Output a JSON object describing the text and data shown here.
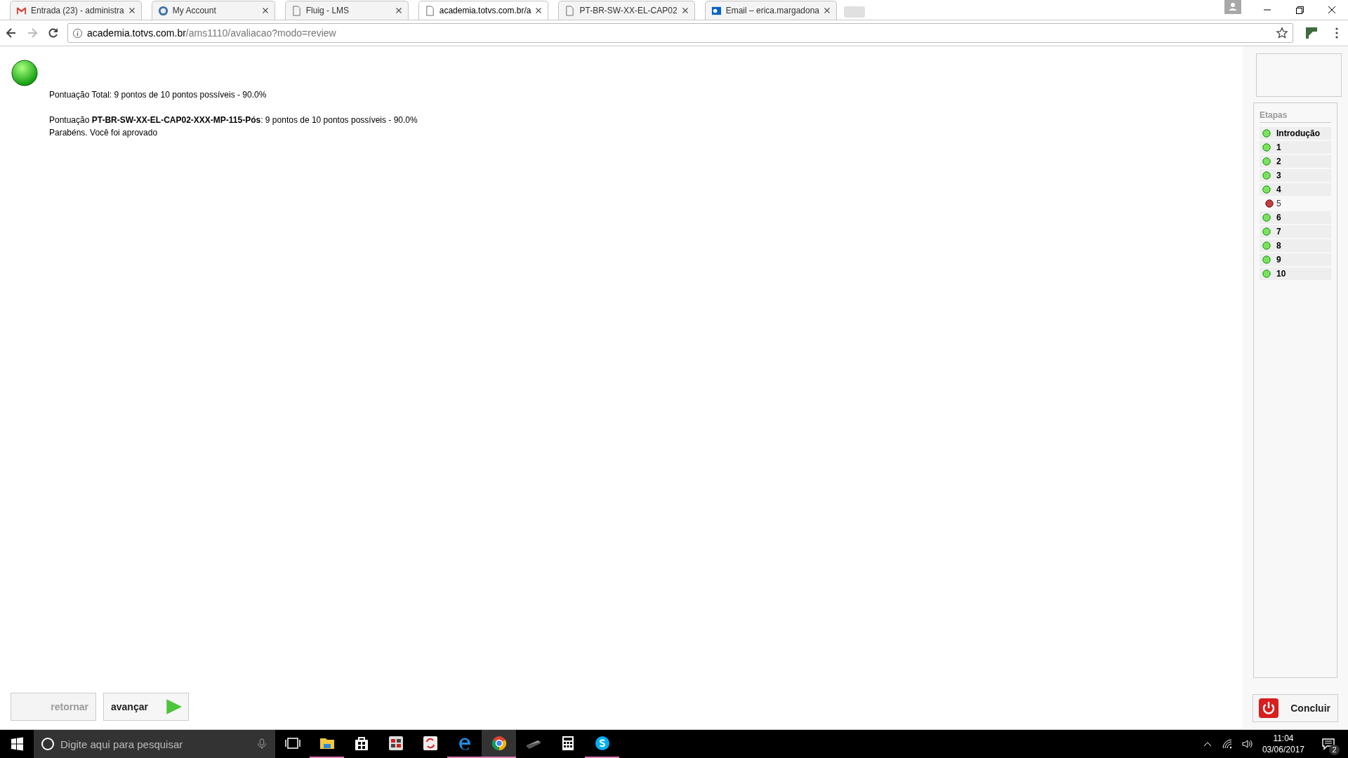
{
  "browser": {
    "tabs": [
      {
        "title": "Entrada (23) - administra",
        "kind": "gmail",
        "selected": false
      },
      {
        "title": "My Account",
        "kind": "circle",
        "selected": false
      },
      {
        "title": "Fluig - LMS",
        "kind": "page",
        "selected": false
      },
      {
        "title": "academia.totvs.com.br/a",
        "kind": "page",
        "selected": true
      },
      {
        "title": "PT-BR-SW-XX-EL-CAP02",
        "kind": "page",
        "selected": false
      },
      {
        "title": "Email – erica.margadona",
        "kind": "outlook",
        "selected": false
      }
    ],
    "url_host": "academia.totvs.com.br",
    "url_path": "/ams1110/avaliacao?modo=review"
  },
  "result": {
    "passed": true,
    "total": "Pontuação Total: 9 pontos de 10 pontos possíveis - 90.0%",
    "detail": "Pontuação **PT-BR-SW-XX-EL-CAP02-XXX-MP-115-Pós**: 9 pontos de 10 pontos possíveis - 90.0%",
    "message": "Parabéns. Você foi aprovado"
  },
  "sidebar": {
    "title": "Etapas",
    "steps": [
      {
        "label": "Introdução",
        "passed": true
      },
      {
        "label": "1",
        "passed": true
      },
      {
        "label": "2",
        "passed": true
      },
      {
        "label": "3",
        "passed": true
      },
      {
        "label": "4",
        "passed": true
      },
      {
        "label": "5",
        "passed": false
      },
      {
        "label": "6",
        "passed": true
      },
      {
        "label": "7",
        "passed": true
      },
      {
        "label": "8",
        "passed": true
      },
      {
        "label": "9",
        "passed": true
      },
      {
        "label": "10",
        "passed": true
      }
    ]
  },
  "buttons": {
    "back": {
      "label": "retornar",
      "disabled": true
    },
    "next": {
      "label": "avançar",
      "disabled": false
    },
    "finish": {
      "label": "Concluir"
    }
  },
  "taskbar": {
    "search_placeholder": "Digite aqui para pesquisar",
    "apps": [
      {
        "kind": "taskview",
        "running": false,
        "selected": false
      },
      {
        "kind": "folder",
        "running": true,
        "selected": false
      },
      {
        "kind": "store",
        "running": false,
        "selected": false
      },
      {
        "kind": "app",
        "running": false,
        "selected": false
      },
      {
        "kind": "sync",
        "running": false,
        "selected": false
      },
      {
        "kind": "edge",
        "running": true,
        "selected": false
      },
      {
        "kind": "chrome",
        "running": true,
        "selected": true
      },
      {
        "kind": "scanner",
        "running": false,
        "selected": false
      },
      {
        "kind": "calculator",
        "running": false,
        "selected": false
      },
      {
        "kind": "skype",
        "running": true,
        "selected": false
      }
    ],
    "time": "11:04",
    "date": "03/06/2017",
    "notifications": "2"
  }
}
